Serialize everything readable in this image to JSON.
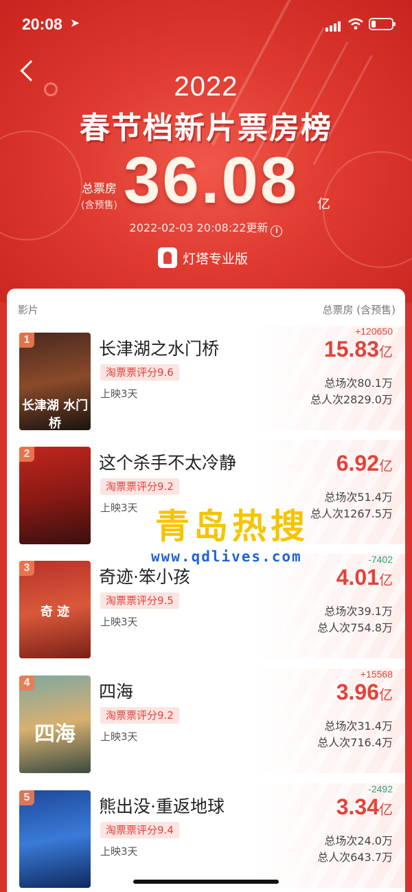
{
  "status_bar": {
    "time": "20:08",
    "location_icon": "location-arrow-icon"
  },
  "header": {
    "back_icon": "chevron-left-icon",
    "year": "2022",
    "title": "春节档新片票房榜",
    "total_label": "总票房",
    "total_sublabel": "(含预售)",
    "total_value": "36.08",
    "total_unit": "亿",
    "updated": "2022-02-03 20:08:22更新",
    "info_icon": "info-icon",
    "brand": "灯塔专业版"
  },
  "table": {
    "col_left": "影片",
    "col_right": "总票房 (含预售)"
  },
  "movies": [
    {
      "rank": "1",
      "name": "长津湖之水门桥",
      "score": "淘票票评分9.6",
      "days": "上映3天",
      "delta": "+120650",
      "delta_dir": "up",
      "box": "15.83",
      "unit": "亿",
      "sessions": "总场次80.1万",
      "viewers": "总人次2829.0万",
      "poster_text": "长津湖 水门桥",
      "poster_colors": [
        "#4a2a20",
        "#8a4a2a",
        "#1a1410"
      ]
    },
    {
      "rank": "2",
      "name": "这个杀手不太冷静",
      "score": "淘票票评分9.2",
      "days": "上映3天",
      "delta": "",
      "delta_dir": "up",
      "box": "6.92",
      "unit": "亿",
      "sessions": "总场次51.4万",
      "viewers": "总人次1267.5万",
      "poster_text": "",
      "poster_colors": [
        "#c0261e",
        "#8a1a14",
        "#3a1010"
      ]
    },
    {
      "rank": "3",
      "name": "奇迹·笨小孩",
      "score": "淘票票评分9.5",
      "days": "上映3天",
      "delta": "-7402",
      "delta_dir": "down",
      "box": "4.01",
      "unit": "亿",
      "sessions": "总场次39.1万",
      "viewers": "总人次754.8万",
      "poster_text": "奇 迹",
      "poster_colors": [
        "#b8322a",
        "#d9593a",
        "#7a2018"
      ]
    },
    {
      "rank": "4",
      "name": "四海",
      "score": "淘票票评分9.2",
      "days": "上映3天",
      "delta": "+15568",
      "delta_dir": "up",
      "box": "3.96",
      "unit": "亿",
      "sessions": "总场次31.4万",
      "viewers": "总人次716.4万",
      "poster_text": "四海",
      "poster_colors": [
        "#7fa8a0",
        "#d8b070",
        "#3a4a40"
      ]
    },
    {
      "rank": "5",
      "name": "熊出没·重返地球",
      "score": "淘票票评分9.4",
      "days": "上映3天",
      "delta": "-2492",
      "delta_dir": "down",
      "box": "3.34",
      "unit": "亿",
      "sessions": "总场次24.0万",
      "viewers": "总人次643.7万",
      "poster_text": "",
      "poster_colors": [
        "#1e4a9a",
        "#3a7ad8",
        "#0e2a60"
      ]
    }
  ],
  "watermark": {
    "text": "青岛热搜",
    "url": "www.qdlives.com"
  }
}
